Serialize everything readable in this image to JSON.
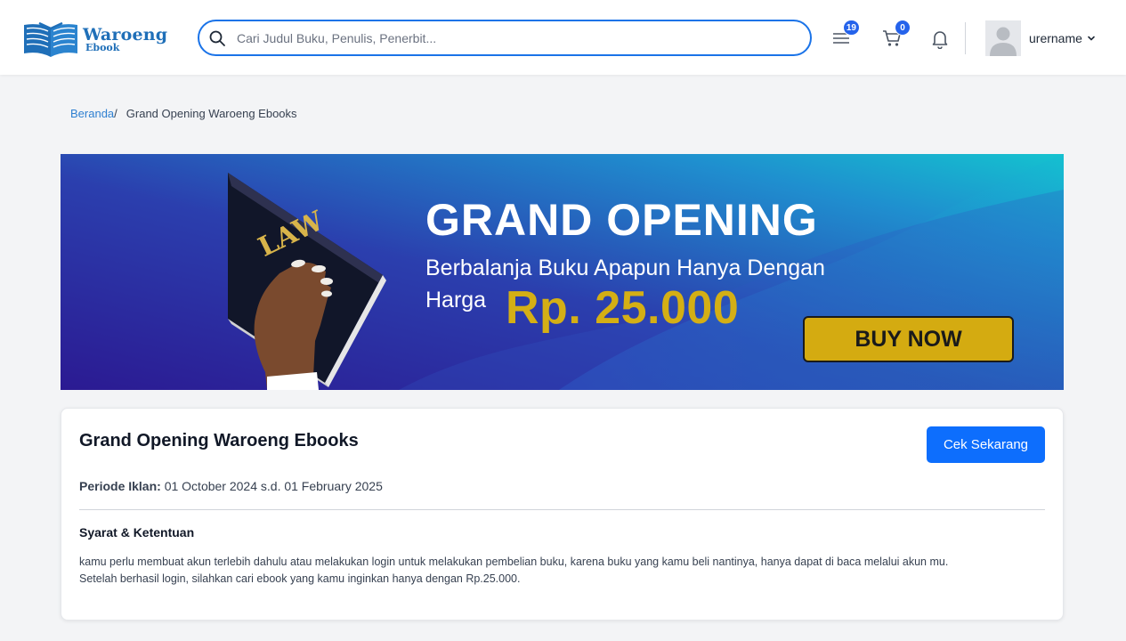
{
  "header": {
    "logo": {
      "title": "Waroeng",
      "subtitle": "Ebook"
    },
    "search": {
      "placeholder": "Cari Judul Buku, Penulis, Penerbit..."
    },
    "menu_badge": "19",
    "cart_badge": "0",
    "username": "urername",
    "accent_color": "#1a73e8"
  },
  "breadcrumb": {
    "home": "Beranda",
    "separator": "/",
    "current": "Grand Opening Waroeng Ebooks"
  },
  "banner": {
    "book_label": "LAW",
    "title": "GRAND OPENING",
    "subtitle": "Berbalanja Buku Apapun Hanya Dengan Harga",
    "price": "Rp. 25.000",
    "button": "BUY NOW"
  },
  "promo": {
    "title": "Grand Opening Waroeng Ebooks",
    "cta": "Cek Sekarang",
    "period_label": "Periode Iklan:",
    "period_value": "01 October 2024 s.d. 01 February 2025",
    "terms_title": "Syarat & Ketentuan",
    "terms_line1": "kamu perlu membuat akun terlebih dahulu atau melakukan login untuk melakukan pembelian buku, karena buku yang kamu beli nantinya, hanya dapat di baca melalui akun mu.",
    "terms_line2": "Setelah berhasil login, silahkan cari ebook yang kamu inginkan hanya dengan Rp.25.000."
  },
  "icons": [
    "search-icon",
    "menu-icon",
    "cart-icon",
    "bell-icon",
    "user-avatar-icon",
    "chevron-down-icon"
  ]
}
